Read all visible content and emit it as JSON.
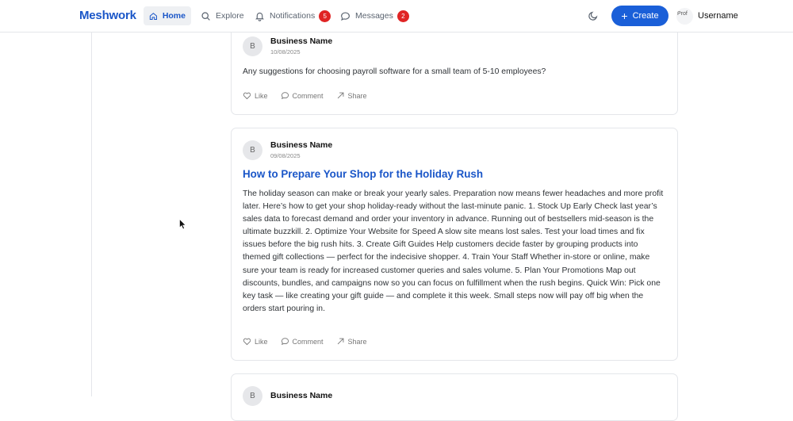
{
  "app": {
    "brand": "Meshwork"
  },
  "nav": {
    "home": "Home",
    "explore": "Explore",
    "notifications": "Notifications",
    "notifications_count": "5",
    "messages": "Messages",
    "messages_count": "2",
    "create": "Create",
    "avatar_alt": "Prof",
    "username": "Username"
  },
  "posts": [
    {
      "avatar": "B",
      "author": "Business Name",
      "date": "10/08/2025",
      "title": "",
      "body": "Any suggestions for choosing payroll software for a small team of 5-10 employees?",
      "actions": {
        "like": "Like",
        "comment": "Comment",
        "share": "Share"
      }
    },
    {
      "avatar": "B",
      "author": "Business Name",
      "date": "09/08/2025",
      "title": "How to Prepare Your Shop for the Holiday Rush",
      "body": "The holiday season can make or break your yearly sales. Preparation now means fewer headaches and more profit later. Here’s how to get your shop holiday-ready without the last-minute panic. 1. Stock Up Early Check last year’s sales data to forecast demand and order your inventory in advance. Running out of bestsellers mid-season is the ultimate buzzkill. 2. Optimize Your Website for Speed A slow site means lost sales. Test your load times and fix issues before the big rush hits. 3. Create Gift Guides Help customers decide faster by grouping products into themed gift collections — perfect for the indecisive shopper. 4. Train Your Staff Whether in-store or online, make sure your team is ready for increased customer queries and sales volume. 5. Plan Your Promotions Map out discounts, bundles, and campaigns now so you can focus on fulfillment when the rush begins. Quick Win: Pick one key task — like creating your gift guide — and complete it this week. Small steps now will pay off big when the orders start pouring in.",
      "actions": {
        "like": "Like",
        "comment": "Comment",
        "share": "Share"
      }
    },
    {
      "avatar": "B",
      "author": "Business Name",
      "date": "",
      "title": "",
      "body": ""
    }
  ],
  "colors": {
    "brand": "#1a56c8",
    "primary_button": "#1a5fd8",
    "badge": "#e02424"
  }
}
